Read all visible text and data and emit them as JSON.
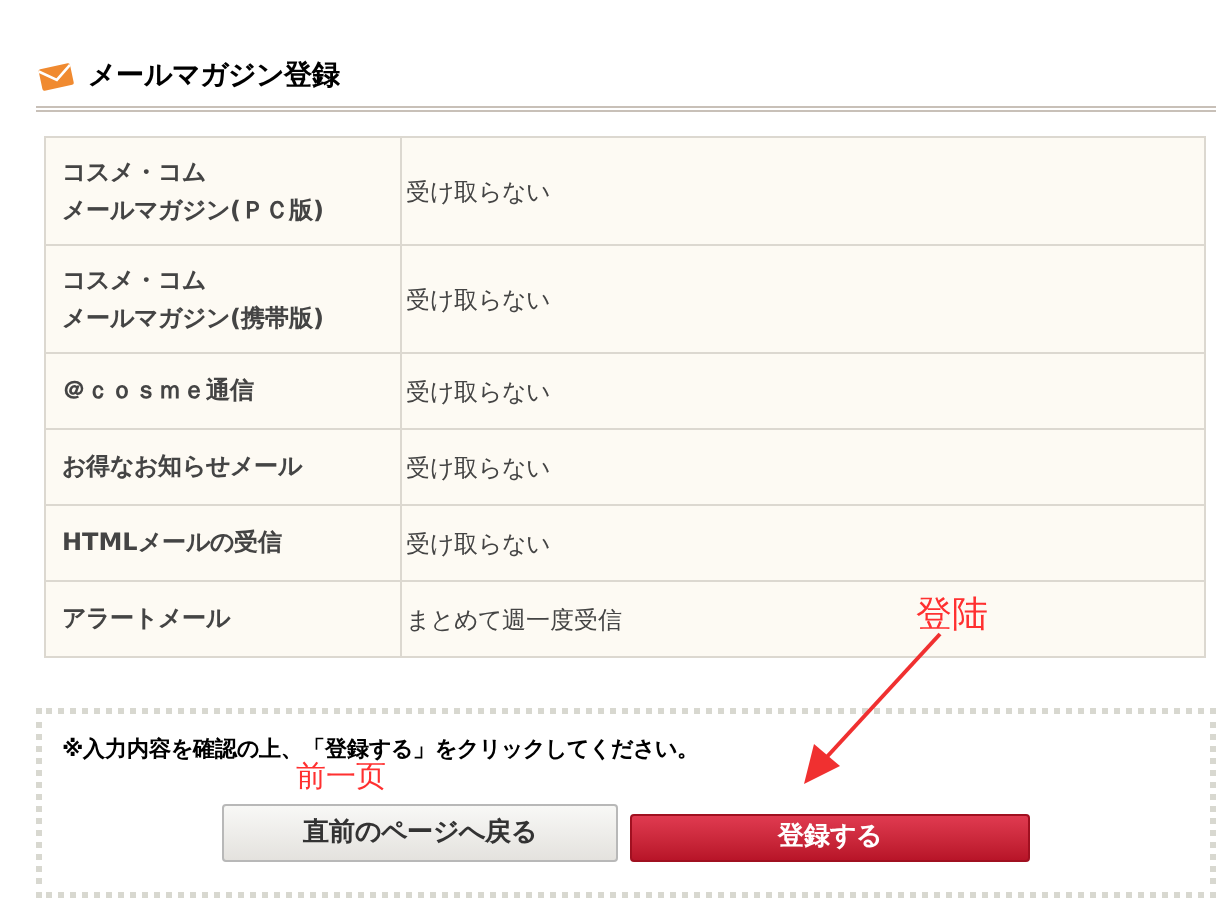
{
  "section": {
    "title": "メールマガジン登録"
  },
  "rows": [
    {
      "label_lines": [
        "コスメ・コム",
        "メールマガジン(ＰＣ版)"
      ],
      "value": "受け取らない"
    },
    {
      "label_lines": [
        "コスメ・コム",
        "メールマガジン(携帯版)"
      ],
      "value": "受け取らない"
    },
    {
      "label_lines": [
        "＠ｃｏｓｍｅ通信"
      ],
      "value": "受け取らない"
    },
    {
      "label_lines": [
        "お得なお知らせメール"
      ],
      "value": "受け取らない"
    },
    {
      "label_lines": [
        "HTMLメールの受信"
      ],
      "value": "受け取らない"
    },
    {
      "label_lines": [
        "アラートメール"
      ],
      "value": "まとめて週一度受信"
    }
  ],
  "notice": "※入力内容を確認の上、「登録する」をクリックしてください。",
  "buttons": [
    {
      "label": "直前のページへ戻る",
      "kind": "secondary"
    },
    {
      "label": "登録する",
      "kind": "primary"
    }
  ],
  "annotations": [
    {
      "text": "登陆"
    },
    {
      "text": "前一页"
    }
  ]
}
